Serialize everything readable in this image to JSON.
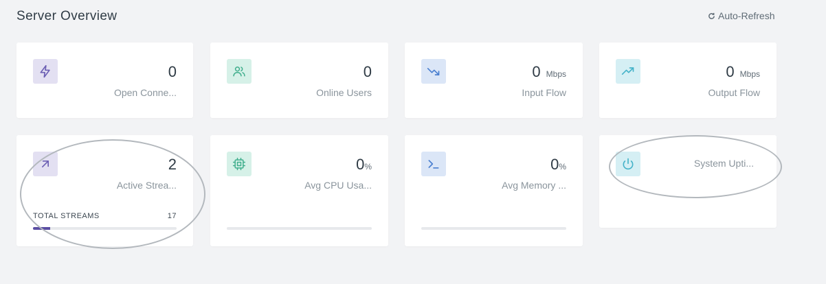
{
  "header": {
    "title": "Server Overview",
    "refresh_label": "Auto-Refresh"
  },
  "colors": {
    "purple": "#6c5fb4",
    "teal": "#3fae8c",
    "blue": "#4a7fd0",
    "cyan": "#45b3c9"
  },
  "cards": [
    {
      "value": "0",
      "unit": "",
      "label": "Open Conne...",
      "icon": "lightning-icon"
    },
    {
      "value": "0",
      "unit": "",
      "label": "Online Users",
      "icon": "users-icon"
    },
    {
      "value": "0",
      "unit": "Mbps",
      "label": "Input Flow",
      "icon": "trend-down-icon"
    },
    {
      "value": "0",
      "unit": "Mbps",
      "label": "Output Flow",
      "icon": "trend-up-icon"
    },
    {
      "value": "2",
      "unit": "",
      "label": "Active Strea...",
      "icon": "arrow-up-right-icon",
      "total_label": "TOTAL STREAMS",
      "total_value": "17",
      "progress_fraction": 0.118
    },
    {
      "value": "0",
      "unit": "%",
      "label": "Avg CPU Usa...",
      "icon": "cpu-icon",
      "progress_fraction": 0
    },
    {
      "value": "0",
      "unit": "%",
      "label": "Avg Memory ...",
      "icon": "terminal-icon",
      "progress_fraction": 0
    },
    {
      "value": "",
      "unit": "",
      "label": "System Upti...",
      "icon": "power-icon"
    }
  ]
}
